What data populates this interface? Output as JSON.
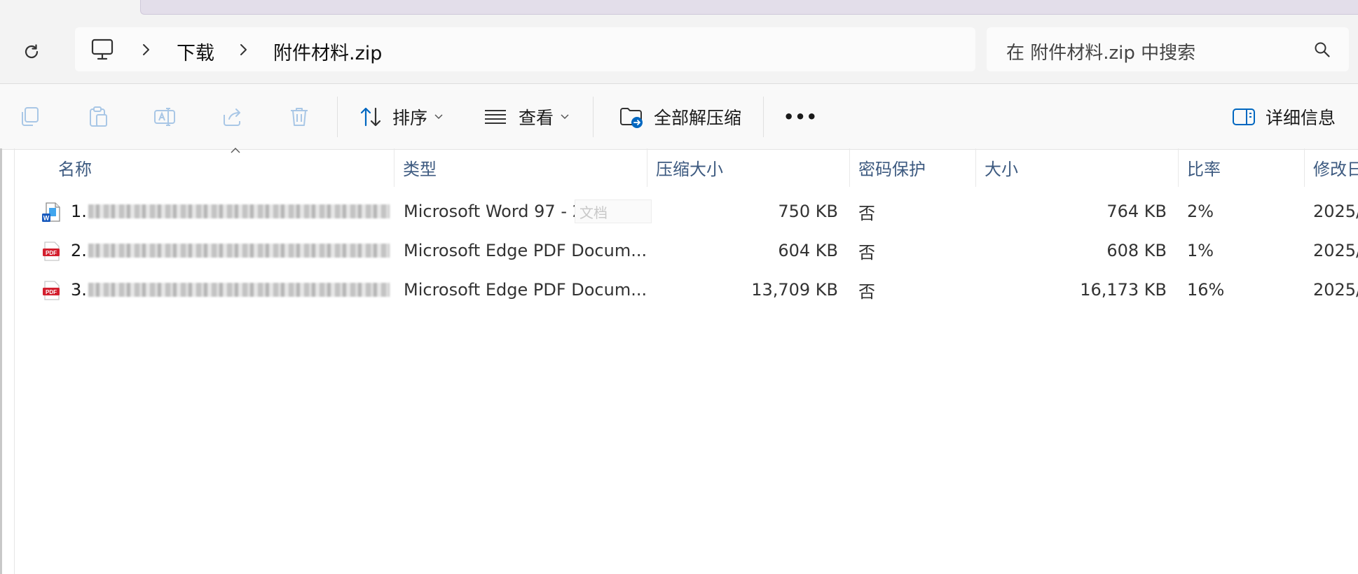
{
  "nav": {
    "breadcrumb": [
      "下载",
      "附件材料.zip"
    ],
    "search_placeholder": "在 附件材料.zip 中搜索"
  },
  "toolbar": {
    "sort_label": "排序",
    "view_label": "查看",
    "extract_all_label": "全部解压缩",
    "more_label": "•••",
    "details_label": "详细信息"
  },
  "columns": [
    "名称",
    "类型",
    "压缩大小",
    "密码保护",
    "大小",
    "比率",
    "修改日"
  ],
  "files": [
    {
      "name": "1.",
      "type": "Microsoft Word 97 - 2003 ...",
      "compressed": "750 KB",
      "password": "否",
      "size": "764 KB",
      "ratio": "2%",
      "modified": "2025/",
      "icon": "word-doc-icon"
    },
    {
      "name": "2.",
      "type": "Microsoft Edge PDF Docum...",
      "compressed": "604 KB",
      "password": "否",
      "size": "608 KB",
      "ratio": "1%",
      "modified": "2025/",
      "icon": "pdf-icon"
    },
    {
      "name": "3.",
      "type": "Microsoft Edge PDF Docum...",
      "compressed": "13,709 KB",
      "password": "否",
      "size": "16,173 KB",
      "ratio": "16%",
      "modified": "2025/",
      "icon": "pdf-icon"
    }
  ],
  "ghost_tooltip": "文档",
  "colors": {
    "accent": "#0067c0",
    "header_text": "#3d5a80",
    "pdf_red": "#d3202f"
  }
}
